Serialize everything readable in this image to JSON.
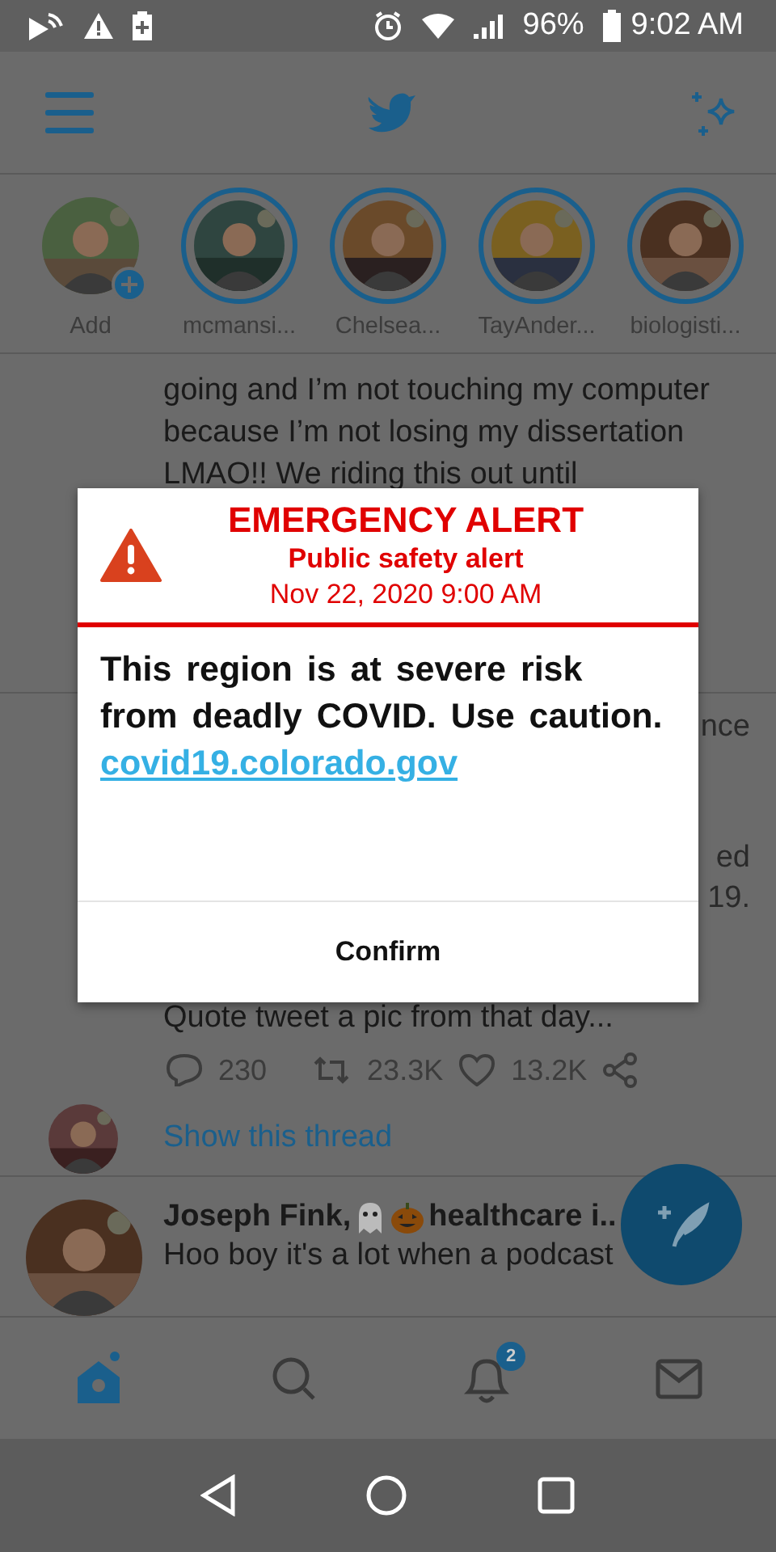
{
  "status_bar": {
    "battery": "96%",
    "time": "9:02 AM"
  },
  "stories": [
    {
      "kind": "add",
      "name": "Add"
    },
    {
      "kind": "story",
      "name": "mcmansi..."
    },
    {
      "kind": "story",
      "name": "Chelsea..."
    },
    {
      "kind": "story",
      "name": "TayAnder..."
    },
    {
      "kind": "story",
      "name": "biologisti..."
    }
  ],
  "tweet_1": {
    "lines": [
      "going and I’m not touching my computer",
      "because I’m not losing my dissertation",
      "LMAO!! We riding this out until"
    ]
  },
  "tweet_2": {
    "fragments": [
      "nce",
      "ed",
      "19."
    ],
    "text": "Quote tweet a pic from that day...",
    "replies": "230",
    "retweets": "23.3K",
    "likes": "13.2K",
    "thread_link": "Show this thread"
  },
  "tweet_3": {
    "name_start": "Joseph Fink,",
    "name_end": "healthcare i..",
    "text": "Hoo boy it's a lot when a podcast"
  },
  "nav": [
    {
      "kind": "home",
      "selected": true
    },
    {
      "kind": "search",
      "selected": false
    },
    {
      "kind": "notifications",
      "selected": false,
      "badge": "2"
    },
    {
      "kind": "messages",
      "selected": false
    }
  ],
  "alert": {
    "title": "EMERGENCY ALERT",
    "subtitle": "Public safety alert",
    "date": "Nov 22, 2020 9:00 AM",
    "body": "This region is at severe risk from deadly COVID. Use caution.",
    "link": "covid19.colorado.gov",
    "button": "Confirm"
  }
}
